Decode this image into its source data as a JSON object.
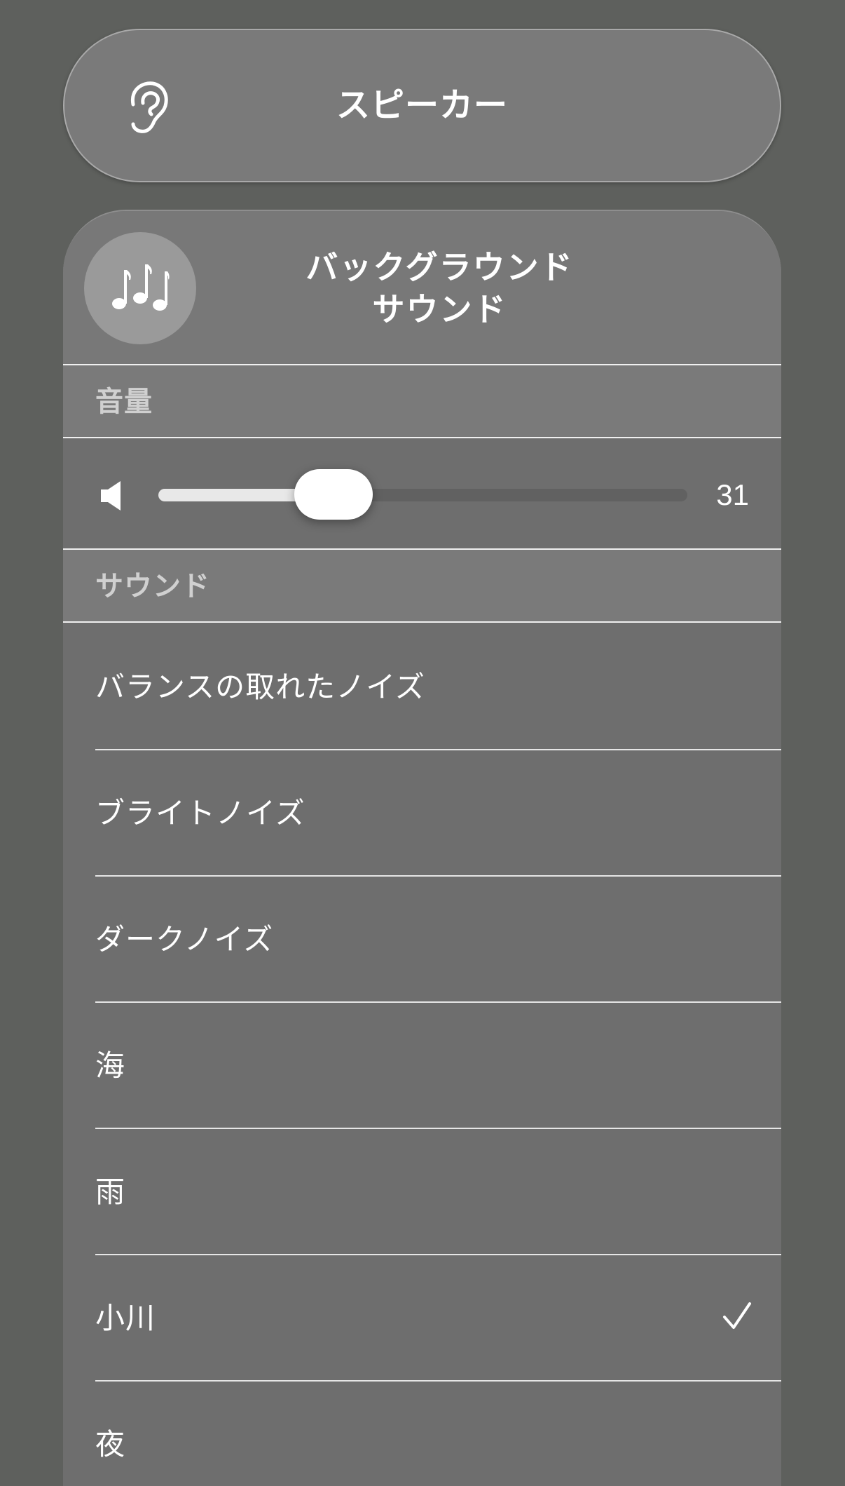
{
  "speaker_button": {
    "label": "スピーカー",
    "icon": "ear-icon"
  },
  "panel": {
    "icon": "music-notes-icon",
    "title_line1": "バックグラウンド",
    "title_line2": "サウンド"
  },
  "volume": {
    "section_label": "音量",
    "icon": "speaker-icon",
    "value": "31",
    "level_percent": 31
  },
  "sounds": {
    "section_label": "サウンド",
    "items": [
      {
        "label": "バランスの取れたノイズ",
        "selected": false
      },
      {
        "label": "ブライトノイズ",
        "selected": false
      },
      {
        "label": "ダークノイズ",
        "selected": false
      },
      {
        "label": "海",
        "selected": false
      },
      {
        "label": "雨",
        "selected": false
      },
      {
        "label": "小川",
        "selected": true
      },
      {
        "label": "夜",
        "selected": false
      }
    ],
    "selected_icon": "checkmark-icon"
  },
  "colors": {
    "background": "#5e605d",
    "panel": "#6e6e6e",
    "header": "#7a7a7a",
    "accent": "#ffffff"
  }
}
